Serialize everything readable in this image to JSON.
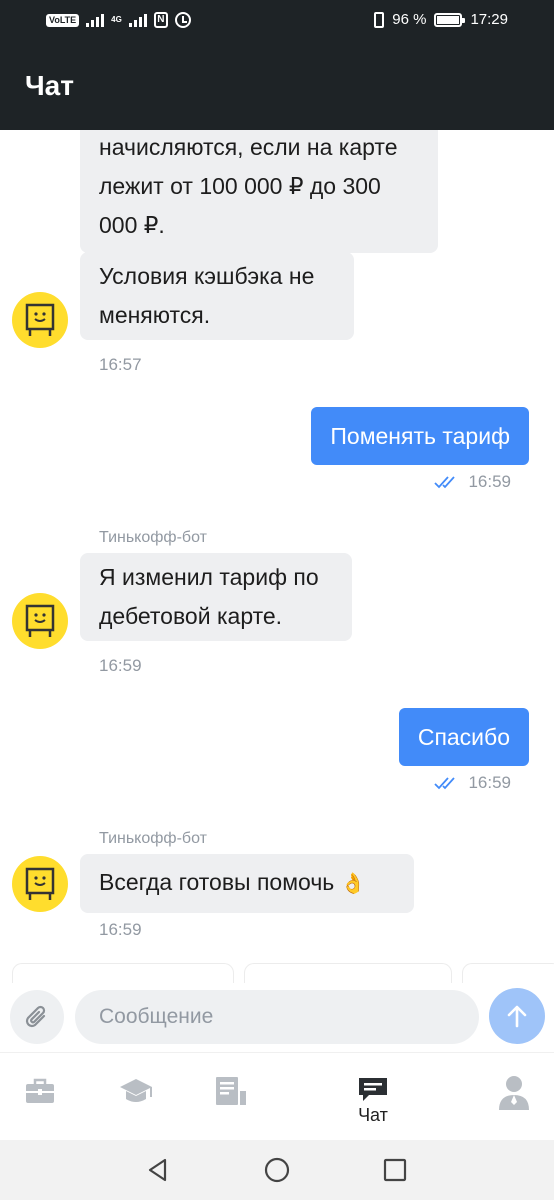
{
  "status_bar": {
    "volte": "VoLTE",
    "network": "4G",
    "battery": "96 %",
    "battery_level": 0.96,
    "time": "17:29"
  },
  "header": {
    "title": "Чат"
  },
  "messages": [
    {
      "direction": "in",
      "lines": [
        "начисляются, если на карте",
        "лежит от 100 000 ₽ до 300",
        "000 ₽."
      ]
    },
    {
      "direction": "in",
      "lines": [
        "Условия кэшбэка не",
        "меняются."
      ],
      "time": "16:57",
      "avatar": "bot-avatar-icon"
    },
    {
      "direction": "out",
      "text": "Поменять тариф",
      "time": "16:59",
      "status_icon": "double-check-icon"
    },
    {
      "direction": "in",
      "sender": "Тинькофф-бот",
      "lines": [
        "Я изменил тариф по",
        "дебетовой карте."
      ],
      "time": "16:59",
      "avatar": "bot-avatar-icon"
    },
    {
      "direction": "out",
      "text": "Спасибо",
      "time": "16:59",
      "status_icon": "double-check-icon"
    },
    {
      "direction": "in",
      "sender": "Тинькофф-бот",
      "text": "Всегда готовы помочь",
      "emoji": "👌",
      "time": "16:59",
      "avatar": "bot-avatar-icon"
    }
  ],
  "composer": {
    "attach_icon": "paperclip-icon",
    "placeholder": "Сообщение",
    "send_icon": "arrow-up-icon"
  },
  "bottom_nav": [
    {
      "icon": "briefcase-icon",
      "label": "",
      "active": false
    },
    {
      "icon": "graduation-cap-icon",
      "label": "",
      "active": false
    },
    {
      "icon": "document-icon",
      "label": "",
      "active": false
    },
    {
      "icon": "chat-icon",
      "label": "Чат",
      "active": true
    },
    {
      "icon": "profile-icon",
      "label": "",
      "active": false
    }
  ],
  "system_nav": [
    "back-icon",
    "home-icon",
    "recents-icon"
  ],
  "colors": {
    "header_bg": "#1e2326",
    "outgoing_bubble": "#428bf9",
    "incoming_bubble": "#eeeff1",
    "bot_avatar": "#ffdd2d",
    "send_button": "#9fc4f9",
    "timestamp": "#9299a2"
  }
}
